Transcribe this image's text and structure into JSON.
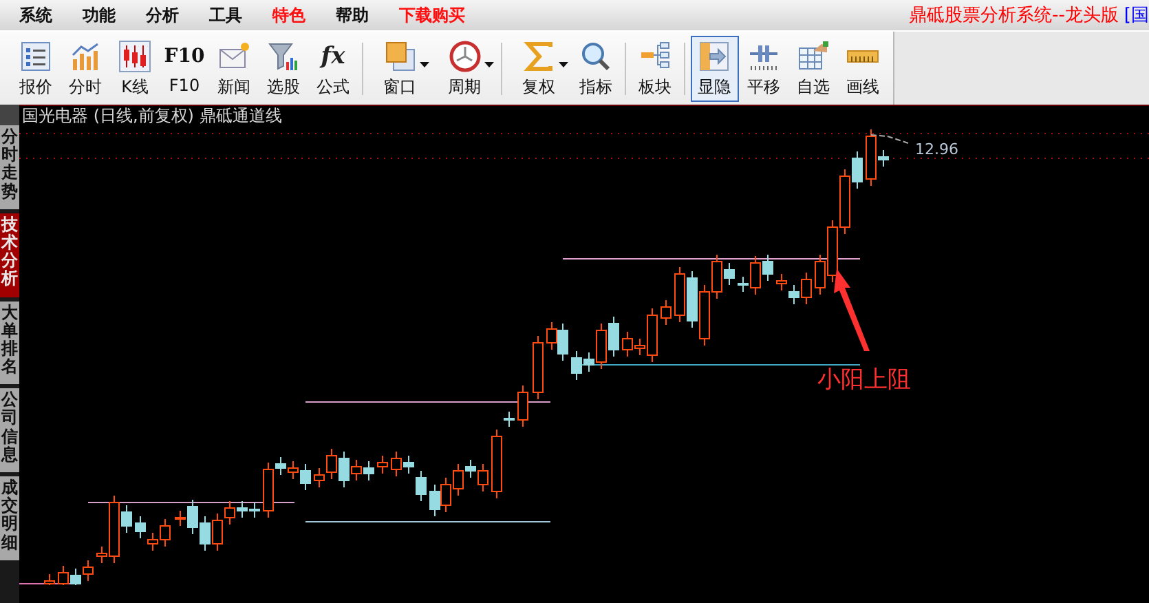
{
  "menu": [
    {
      "label": "系统",
      "highlight": false
    },
    {
      "label": "功能",
      "highlight": false
    },
    {
      "label": "分析",
      "highlight": false
    },
    {
      "label": "工具",
      "highlight": false
    },
    {
      "label": "特色",
      "highlight": true
    },
    {
      "label": "帮助",
      "highlight": false
    },
    {
      "label": "下载购买",
      "highlight": true
    }
  ],
  "app_title": {
    "text": "鼎砥股票分析系统--龙头版",
    "suffix": "[国"
  },
  "toolbar": [
    [
      {
        "label": "报价",
        "kind": "picture",
        "selected": false,
        "has_menu": false
      },
      {
        "label": "分时",
        "kind": "picture",
        "selected": false,
        "has_menu": false
      },
      {
        "label": "K线",
        "kind": "picture",
        "selected": false,
        "has_menu": false
      },
      {
        "label": "F10",
        "kind": "label-glyph",
        "glyph": "F10",
        "selected": false,
        "has_menu": false
      },
      {
        "label": "新闻",
        "kind": "picture",
        "selected": false,
        "has_menu": false
      },
      {
        "label": "选股",
        "kind": "picture",
        "selected": false,
        "has_menu": false
      },
      {
        "label": "公式",
        "kind": "script-glyph",
        "glyph": "fx",
        "selected": false,
        "has_menu": false
      }
    ],
    [
      {
        "label": "窗口",
        "kind": "picture",
        "selected": false,
        "has_menu": true
      },
      {
        "label": "周期",
        "kind": "picture",
        "selected": false,
        "has_menu": true
      }
    ],
    [
      {
        "label": "复权",
        "kind": "picture",
        "selected": false,
        "has_menu": true
      },
      {
        "label": "指标",
        "kind": "picture",
        "selected": false,
        "has_menu": false
      }
    ],
    [
      {
        "label": "板块",
        "kind": "picture",
        "selected": false,
        "has_menu": false
      }
    ],
    [
      {
        "label": "显隐",
        "kind": "picture",
        "selected": true,
        "has_menu": false
      },
      {
        "label": "平移",
        "kind": "picture",
        "selected": false,
        "has_menu": false
      },
      {
        "label": "自选",
        "kind": "picture",
        "selected": false,
        "has_menu": false
      },
      {
        "label": "画线",
        "kind": "picture",
        "selected": false,
        "has_menu": false
      }
    ]
  ],
  "sidebar": {
    "tabs": [
      {
        "label": "分时走势",
        "selected": false
      },
      {
        "label": "技术分析",
        "selected": true
      },
      {
        "label": "大单排名",
        "selected": false
      },
      {
        "label": "公司信息",
        "selected": false
      },
      {
        "label": "成交明细",
        "selected": false
      }
    ]
  },
  "chart": {
    "title": "国光电器 (日线,前复权) 鼎砥通道线",
    "price_label": "12.96",
    "annotation": "小阳上阻"
  }
}
